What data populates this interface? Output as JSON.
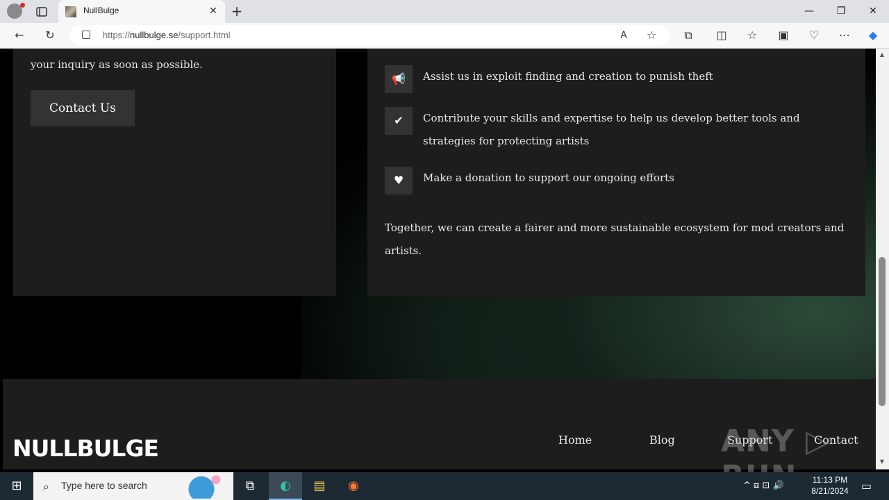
{
  "browser": {
    "tab_title": "NullBulge",
    "url_prefix": "https://",
    "url_host": "nullbulge.se",
    "url_path": "/support.html",
    "icons": {
      "profile": "profile-icon",
      "tab_actions": "tab-actions-icon",
      "close_tab": "close-icon",
      "new_tab": "plus-icon",
      "back": "back-arrow-icon",
      "refresh": "refresh-icon",
      "read_aloud": "read-aloud-icon",
      "favorite": "star-icon",
      "extensions": "puzzle-icon",
      "split": "split-screen-icon",
      "favorites": "favorites-icon",
      "collections": "collections-icon",
      "performance": "heart-pulse-icon",
      "more": "more-icon",
      "copilot": "copilot-icon"
    },
    "glyphs": {
      "close": "✕",
      "new_tab": "+",
      "minimize": "—",
      "restore": "❐",
      "back": "←",
      "refresh": "↻",
      "read_aloud": "A",
      "star": "☆",
      "puzzle": "⧉",
      "split": "◫",
      "favorites": "☆",
      "collections": "▣",
      "performance": "♡",
      "more": "⋯",
      "copilot": "◆"
    }
  },
  "left_card": {
    "partial_text": "your inquiry as soon as possible.",
    "contact_button": "Contact Us"
  },
  "right_card": {
    "items": [
      {
        "icon": "megaphone-icon",
        "glyph": "📢",
        "text": "Assist us in exploit finding and creation to punish theft"
      },
      {
        "icon": "hand-check-icon",
        "glyph": "✔",
        "text": "Contribute your skills and expertise to help us develop better tools and strategies for protecting artists"
      },
      {
        "icon": "hand-heart-icon",
        "glyph": "♥",
        "text": "Make a donation to support our ongoing efforts"
      }
    ],
    "summary": "Together, we can create a fairer and more sustainable ecosystem for mod creators and artists."
  },
  "footer": {
    "logo": "NULLBULGE",
    "nav": [
      "Home",
      "Blog",
      "Support",
      "Contact"
    ]
  },
  "watermark": "ANY ▷ RUN",
  "taskbar": {
    "start_glyph": "⊞",
    "search_glyph": "⌕",
    "search_placeholder": "Type here to search",
    "task_view_glyph": "⧉",
    "edge_glyph": "◐",
    "explorer_glyph": "▤",
    "firefox_glyph": "◉",
    "tray_glyphs": "^  ⧈  ⊡  🔊",
    "notification_glyph": "▭",
    "time": "11:13 PM",
    "date": "8/21/2024"
  }
}
